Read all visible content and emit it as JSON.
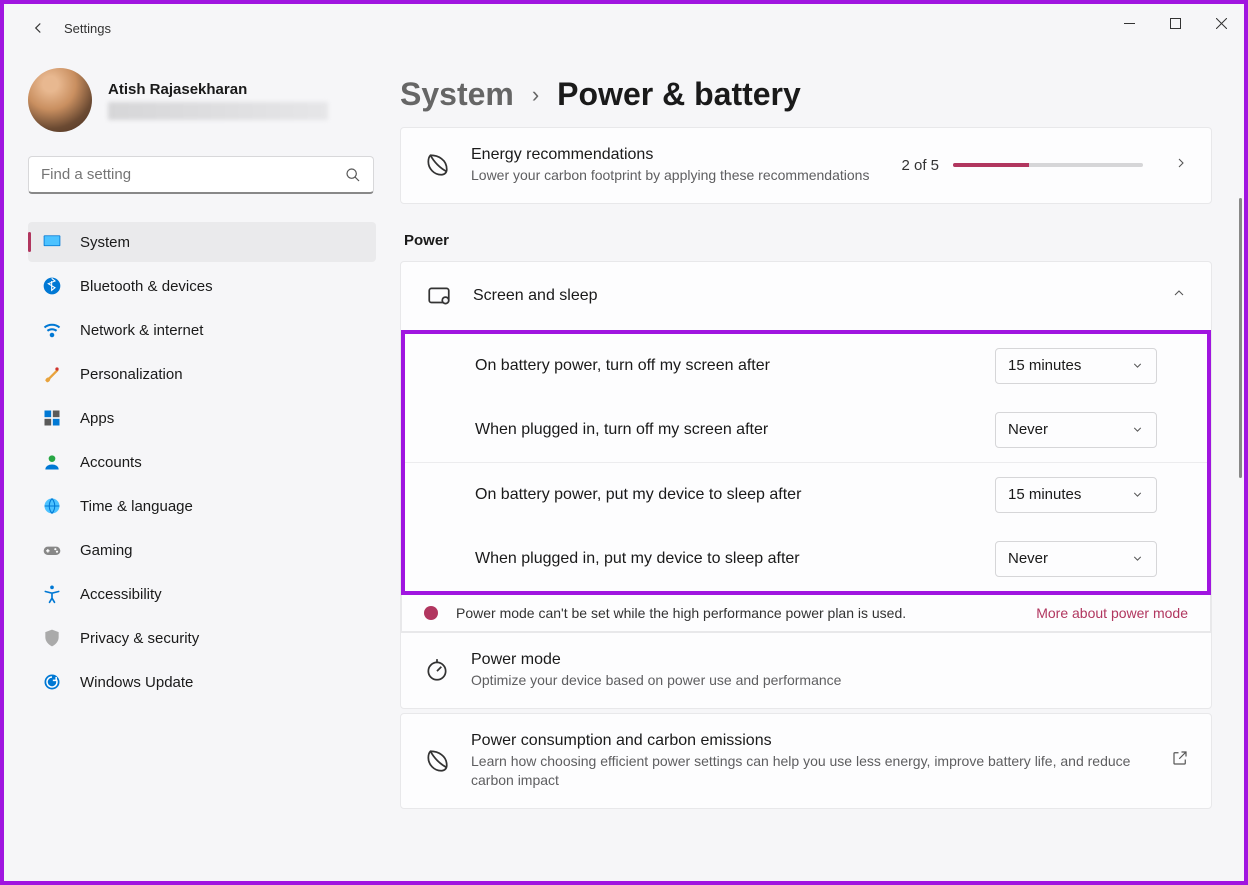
{
  "titlebar": {
    "title": "Settings"
  },
  "profile": {
    "name": "Atish Rajasekharan"
  },
  "search": {
    "placeholder": "Find a setting"
  },
  "sidebar": {
    "items": [
      {
        "label": "System",
        "icon": "monitor",
        "active": true
      },
      {
        "label": "Bluetooth & devices",
        "icon": "bluetooth"
      },
      {
        "label": "Network & internet",
        "icon": "wifi"
      },
      {
        "label": "Personalization",
        "icon": "brush"
      },
      {
        "label": "Apps",
        "icon": "grid"
      },
      {
        "label": "Accounts",
        "icon": "person"
      },
      {
        "label": "Time & language",
        "icon": "globe"
      },
      {
        "label": "Gaming",
        "icon": "gamepad"
      },
      {
        "label": "Accessibility",
        "icon": "accessibility"
      },
      {
        "label": "Privacy & security",
        "icon": "shield"
      },
      {
        "label": "Windows Update",
        "icon": "update"
      }
    ]
  },
  "breadcrumb": {
    "parent": "System",
    "current": "Power & battery"
  },
  "energy": {
    "title": "Energy recommendations",
    "sub": "Lower your carbon footprint by applying these recommendations",
    "progress_text": "2 of 5",
    "progress_pct": 40
  },
  "section_power": "Power",
  "screen_sleep": {
    "title": "Screen and sleep",
    "rows": [
      {
        "label": "On battery power, turn off my screen after",
        "value": "15 minutes"
      },
      {
        "label": "When plugged in, turn off my screen after",
        "value": "Never"
      },
      {
        "label": "On battery power, put my device to sleep after",
        "value": "15 minutes"
      },
      {
        "label": "When plugged in, put my device to sleep after",
        "value": "Never"
      }
    ]
  },
  "banner": {
    "text": "Power mode can't be set while the high performance power plan is used.",
    "link": "More about power mode"
  },
  "power_mode": {
    "title": "Power mode",
    "sub": "Optimize your device based on power use and performance"
  },
  "carbon": {
    "title": "Power consumption and carbon emissions",
    "sub": "Learn how choosing efficient power settings can help you use less energy, improve battery life, and reduce carbon impact"
  }
}
